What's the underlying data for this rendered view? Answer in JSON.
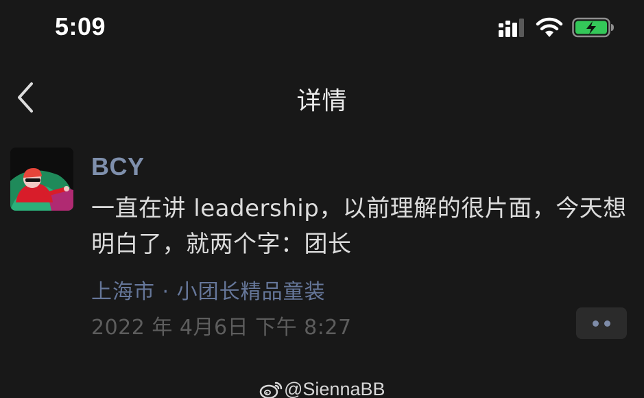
{
  "status_bar": {
    "time": "5:09",
    "battery_color": "#34c759",
    "icons": [
      "signal-icon",
      "wifi-icon",
      "battery-charging-icon"
    ]
  },
  "nav": {
    "title": "详情",
    "back_icon": "chevron-left-icon"
  },
  "post": {
    "author": "BCY",
    "text": "一直在讲 leadership，以前理解的很片面，今天想明白了，就两个字：团长",
    "location": "上海市 · 小团长精品童装",
    "timestamp": "2022 年 4月6日 下午 8:27",
    "more_icon": "more-dots-icon",
    "name_color": "#7f90ad",
    "location_color": "#66779a"
  },
  "watermark": {
    "text": "@SiennaBB",
    "logo_icon": "weibo-logo-icon"
  }
}
